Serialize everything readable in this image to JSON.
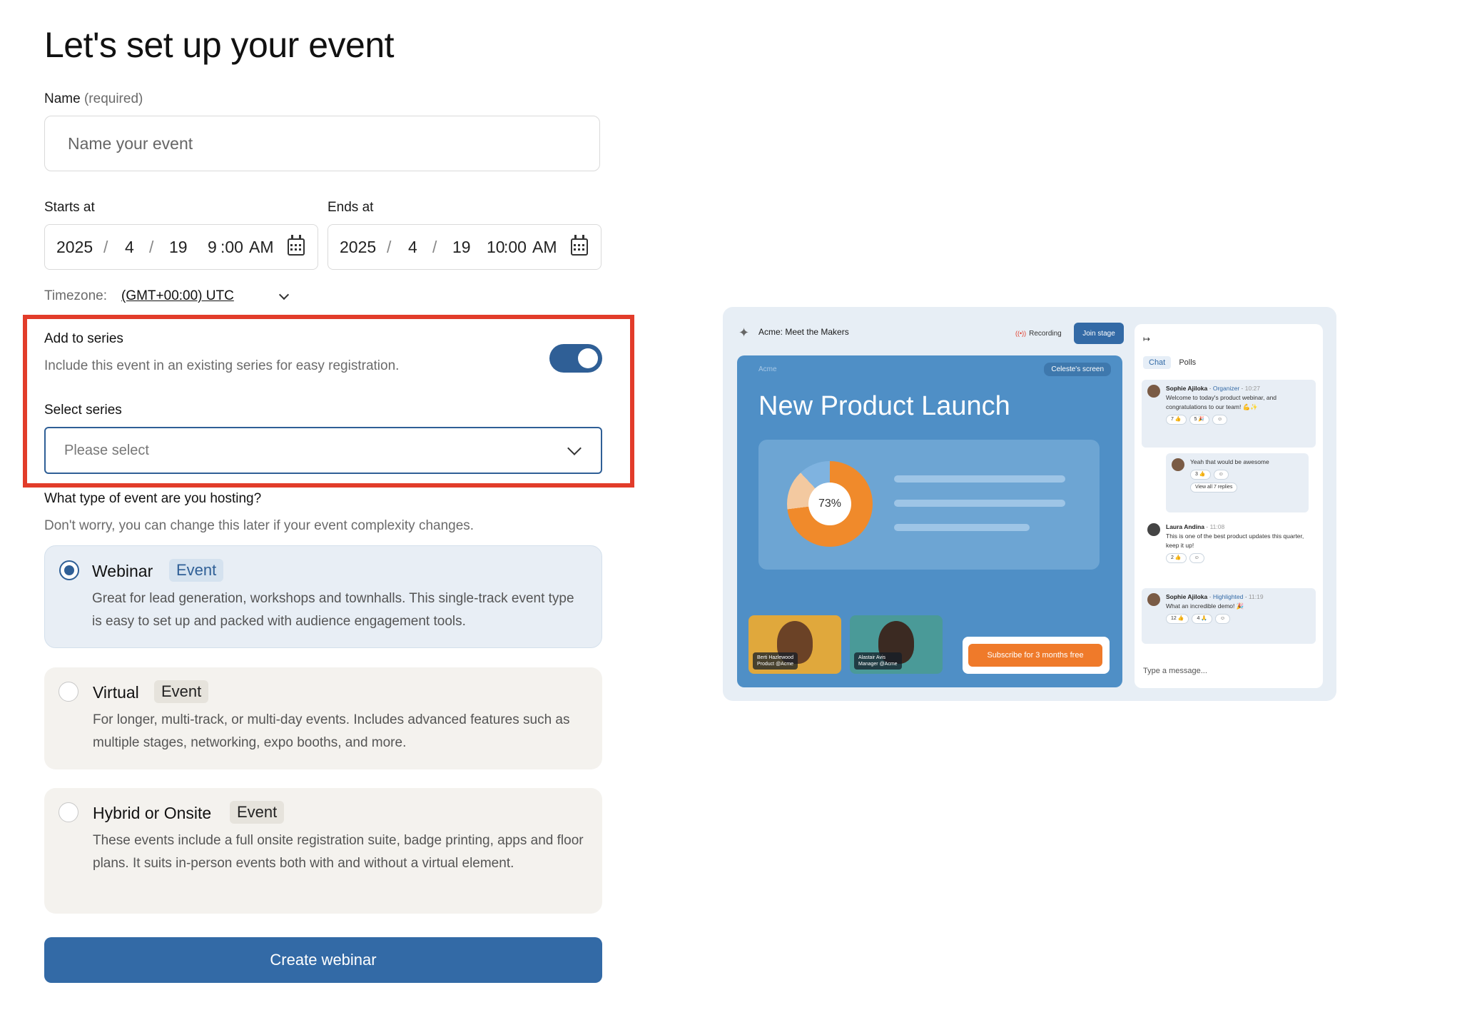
{
  "page": {
    "title": "Let's set up your event"
  },
  "name_field": {
    "label": "Name",
    "required": "(required)",
    "placeholder": "Name your event"
  },
  "start": {
    "label": "Starts at",
    "year": "2025",
    "month": "4",
    "day": "19",
    "hour": "9",
    "minute": ":00",
    "ampm": "AM"
  },
  "end": {
    "label": "Ends at",
    "year": "2025",
    "month": "4",
    "day": "19",
    "hour": "10",
    "minute": ":00",
    "ampm": "AM"
  },
  "timezone": {
    "label": "Timezone:",
    "value": "(GMT+00:00) UTC"
  },
  "series": {
    "title": "Add to series",
    "subtitle": "Include this event in an existing series for easy registration.",
    "toggle_on": true,
    "select_label": "Select series",
    "select_placeholder": "Please select"
  },
  "event_type": {
    "question": "What type of event are you hosting?",
    "hint": "Don't worry, you can change this later if your event complexity changes.",
    "options": [
      {
        "title": "Webinar",
        "badge": "Event",
        "selected": true,
        "description": "Great for lead generation, workshops and townhalls. This single-track event type is easy to set up and packed with audience engagement tools."
      },
      {
        "title": "Virtual",
        "badge": "Event",
        "selected": false,
        "description": "For longer, multi-track, or multi-day events. Includes advanced features such as multiple stages, networking, expo booths, and more."
      },
      {
        "title": "Hybrid or Onsite",
        "badge": "Event",
        "selected": false,
        "description": "These events include a full onsite registration suite, badge printing, apps and floor plans. It suits in-person events both with and without a virtual element."
      }
    ]
  },
  "cta": {
    "label": "Create webinar"
  },
  "preview": {
    "event_name": "Acme: Meet the Makers",
    "recording": "Recording",
    "join_stage": "Join stage",
    "stage_brand": "Acme",
    "screen_share": "Celeste's screen",
    "stage_title": "New Product Launch",
    "donut_value": "73%",
    "speaker1_name": "Berti Hazlewood",
    "speaker1_role": "Product @Acme",
    "speaker2_name": "Alastair Avis",
    "speaker2_role": "Manager @Acme",
    "subscribe": "Subscribe for 3 months free",
    "chat_tab": "Chat",
    "polls_tab": "Polls",
    "messages": [
      {
        "author": "Sophie Ajiloka",
        "role": "Organizer",
        "time": "10:27",
        "text": "Welcome to today's product webinar, and congratulations to our team! 💪✨",
        "reactions": [
          "7 👍",
          "5 🎉",
          "☺"
        ]
      },
      {
        "author": "",
        "role": "",
        "time": "",
        "text": "Yeah that would be awesome",
        "reactions": [
          "3 👍",
          "☺"
        ],
        "extra": "View all 7 replies"
      },
      {
        "author": "Laura Andina",
        "role": "",
        "time": "11:08",
        "text": "This is one of the best product updates this quarter, keep it up!",
        "reactions": [
          "2 👍",
          "☺"
        ]
      },
      {
        "author": "Sophie Ajiloka",
        "role": "Highlighted",
        "time": "11:19",
        "text": "What an incredible demo! 🎉",
        "reactions": [
          "12 👍",
          "4 🙏",
          "☺"
        ]
      }
    ],
    "chat_placeholder": "Type a message..."
  }
}
